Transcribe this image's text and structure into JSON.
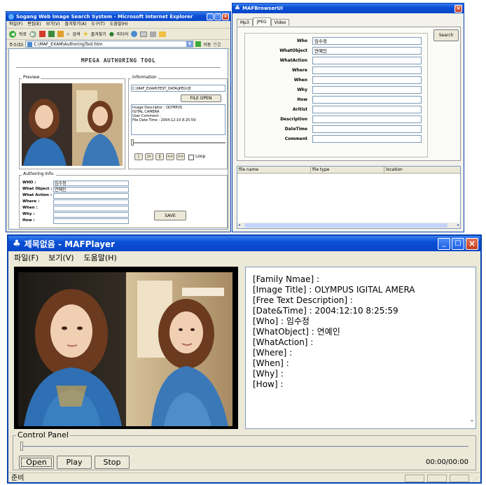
{
  "ie": {
    "title": "Sogang Web Image Search System - Microsoft Internet Explorer",
    "menu": [
      "파일(F)",
      "편집(E)",
      "보기(V)",
      "즐겨찾기(A)",
      "도구(T)",
      "도움말(H)"
    ],
    "toolbar": [
      "뒤로",
      "검색",
      "즐겨찾기",
      "미디어"
    ],
    "address_label": "주소(D)",
    "address": "C:\\MAF_EXAM\\AuthoringTool.htm",
    "go_label": "이동",
    "links_label": "연결",
    "heading": "MPEGA AUTHORING TOOL",
    "preview_label": "Preview",
    "info_label": "Information",
    "path_value": "C:\\MAF_EXAM\\TEST_DATA\\JPEG\\영",
    "file_open": "FILE OPEN",
    "desc_lines": [
      "Image Descriptor : OLYMPUS",
      "IGITAL CAMERA",
      "User Comment :",
      "File Date Time : 2004:12:10 8:25:59"
    ],
    "controls": [
      "|",
      "|>",
      "||",
      "<<",
      ">>"
    ],
    "loop_label": "Loop",
    "authoring_label": "Authoring Info.",
    "fields": [
      {
        "label": "WHO :",
        "value": "임수정"
      },
      {
        "label": "What Object :",
        "value": "연예인"
      },
      {
        "label": "What Action :",
        "value": ""
      },
      {
        "label": "Where :",
        "value": ""
      },
      {
        "label": "When :",
        "value": ""
      },
      {
        "label": "Why :",
        "value": ""
      },
      {
        "label": "How :",
        "value": ""
      }
    ],
    "save": "SAVE"
  },
  "browser": {
    "title": "MAFBrowserUI",
    "tabs": [
      "Mp3",
      "JPEG",
      "Video"
    ],
    "search": "Search",
    "fields": [
      {
        "label": "Who",
        "value": "임수정"
      },
      {
        "label": "WhatObject",
        "value": "연예인"
      },
      {
        "label": "WhatAction",
        "value": ""
      },
      {
        "label": "Where",
        "value": ""
      },
      {
        "label": "When",
        "value": ""
      },
      {
        "label": "Why",
        "value": ""
      },
      {
        "label": "How",
        "value": ""
      },
      {
        "label": "Aritist",
        "value": ""
      },
      {
        "label": "Description",
        "value": ""
      },
      {
        "label": "DateTime",
        "value": ""
      },
      {
        "label": "Comment",
        "value": ""
      }
    ],
    "columns": [
      "file name",
      "file type",
      "location"
    ]
  },
  "player": {
    "title": "제목없음 - MAFPlayer",
    "menu": [
      "파일(F)",
      "보기(V)",
      "도움말(H)"
    ],
    "metadata": [
      "[Family Nmae] :",
      "[Image Title] : OLYMPUS IGITAL AMERA",
      "[Free Text Description] :",
      "[Date&Time] : 2004:12:10 8:25:59",
      "[Who] : 임수정",
      "[WhatObject] : 연예인",
      "[WhatAction] :",
      "[Where] :",
      "[When] :",
      "[Why] :",
      "[How] :"
    ],
    "control_panel": "Control Panel",
    "open": "Open",
    "play": "Play",
    "stop": "Stop",
    "time": "00:00/00:00",
    "status": "준비"
  },
  "colors": {
    "xp_blue": "#0a4fd6",
    "sweater_blue": "#2f6fb3",
    "hair": "#6b3a1f",
    "station": "#c9b089"
  }
}
